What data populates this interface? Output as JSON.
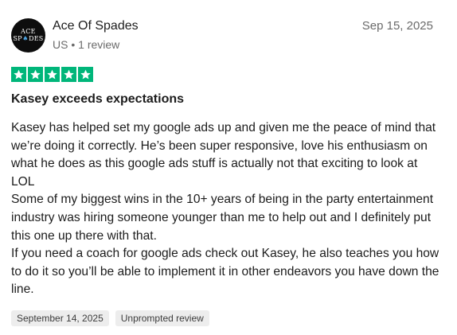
{
  "reviewer": {
    "avatar_text_top": "ACE",
    "avatar_text_bottom_left": "SP",
    "avatar_text_bottom_right": "DES",
    "avatar_icon": "spade-icon",
    "name": "Ace Of Spades",
    "location": "US",
    "separator": "•",
    "review_count": "1 review"
  },
  "review": {
    "date": "Sep 15, 2025",
    "rating": 5,
    "rating_max": 5,
    "star_color": "#00b67a",
    "title": "Kasey exceeds expectations",
    "paragraphs": [
      "Kasey has helped set my google ads up and given me the peace of mind that we’re doing it correctly. He’s been super responsive, love his enthusiasm on what he does as this google ads stuff is actually not that exciting to look at LOL",
      "Some of my biggest wins in the 10+ years of being in the party entertainment industry was hiring someone younger than me to help out and I definitely put this one up there with that.",
      "If you need a coach for google ads check out Kasey, he also teaches you how to do it so you’ll be able to implement it in other endeavors you have down the line."
    ],
    "experience_date": "September 14, 2025",
    "label": "Unprompted review"
  }
}
